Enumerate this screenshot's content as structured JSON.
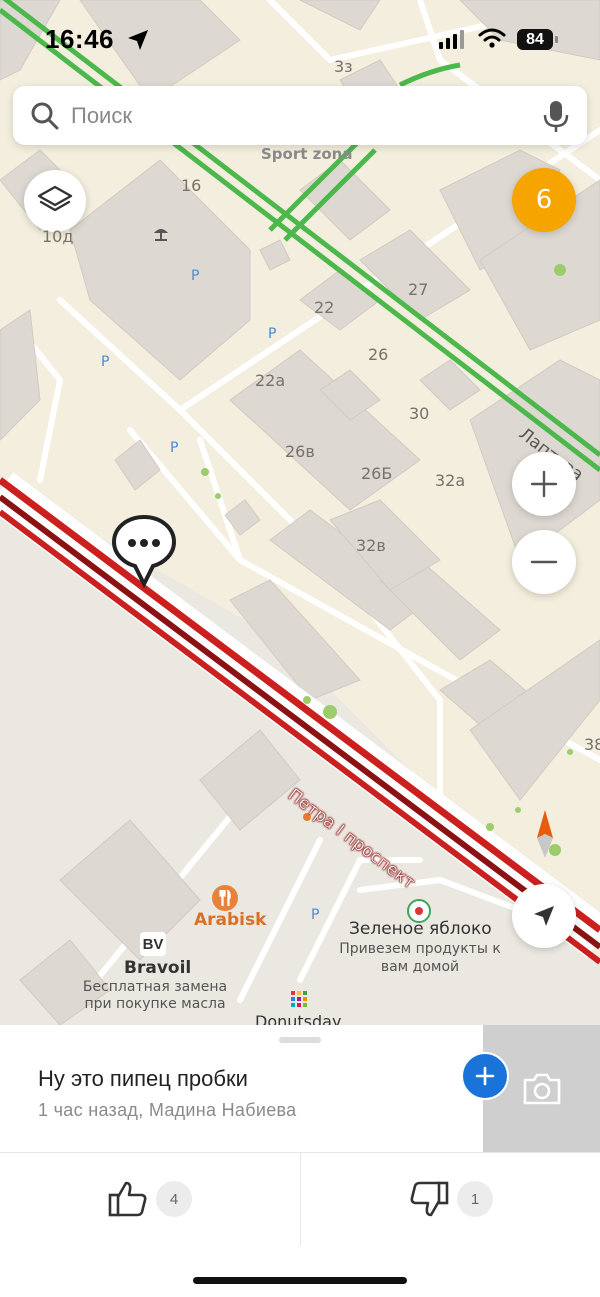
{
  "status_bar": {
    "time": "16:46",
    "battery": "84"
  },
  "search": {
    "placeholder": "Поиск"
  },
  "map": {
    "house_numbers": [
      "3з",
      "16",
      "10д",
      "22",
      "27",
      "26",
      "22а",
      "30",
      "26в",
      "26Б",
      "32а",
      "32в",
      "38"
    ],
    "street_labels": {
      "peter": "Петра I проспект",
      "lapteva": "Лаптева"
    },
    "places": {
      "sport_zona": "Sport zona",
      "arabisk": "Arabisk",
      "bravoil": {
        "name": "Bravoil",
        "desc": "Бесплатная замена при покупке масла",
        "logo": "BV"
      },
      "zelenoe": {
        "name": "Зеленое яблоко",
        "desc": "Привезем продукты к вам домой"
      },
      "donutsday": "Donutsday"
    },
    "parking_label": "P",
    "layers_badge": "10д",
    "counter_badge": "6",
    "colors": {
      "map_bg": "#f3eedd",
      "traffic_green": "#4cb84c",
      "traffic_red": "#cc2020",
      "badge_orange": "#f5a400",
      "accent_blue": "#1a73d9"
    }
  },
  "report": {
    "comment": "Ну это пипец пробки",
    "meta": "1 час назад, Мадина Набиева",
    "likes": "4",
    "dislikes": "1"
  },
  "icons": [
    "search-icon",
    "mic-icon",
    "layers-icon",
    "plus-icon",
    "minus-icon",
    "compass-icon",
    "navigate-arrow-icon",
    "chat-bubble-icon",
    "camera-icon",
    "thumbs-up-icon",
    "thumbs-down-icon",
    "location-arrow-icon"
  ]
}
